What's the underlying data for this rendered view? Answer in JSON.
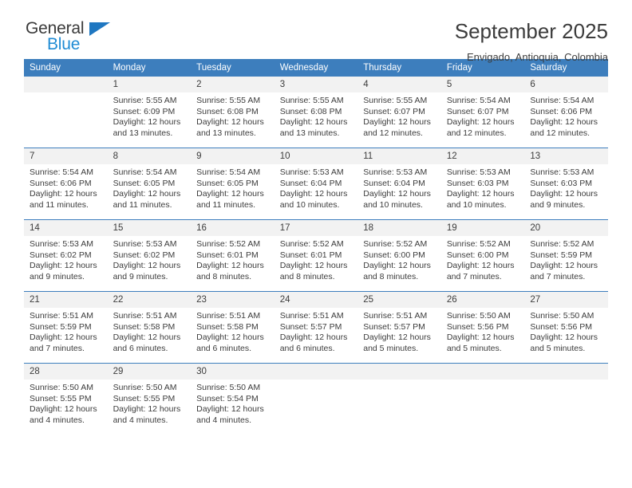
{
  "brand": {
    "name_part1": "General",
    "name_part2": "Blue",
    "accent_color": "#1f8bd4",
    "triangle_color": "#1f77c1"
  },
  "header": {
    "title": "September 2025",
    "subtitle": "Envigado, Antioquia, Colombia"
  },
  "calendar": {
    "header_color": "#3d7ebd",
    "daynum_bg": "#f2f2f2",
    "weekday_headers": [
      "Sunday",
      "Monday",
      "Tuesday",
      "Wednesday",
      "Thursday",
      "Friday",
      "Saturday"
    ],
    "weeks": [
      [
        {
          "day": "",
          "sunrise": "",
          "sunset": "",
          "daylight_line1": "",
          "daylight_line2": ""
        },
        {
          "day": "1",
          "sunrise": "Sunrise: 5:55 AM",
          "sunset": "Sunset: 6:09 PM",
          "daylight_line1": "Daylight: 12 hours",
          "daylight_line2": "and 13 minutes."
        },
        {
          "day": "2",
          "sunrise": "Sunrise: 5:55 AM",
          "sunset": "Sunset: 6:08 PM",
          "daylight_line1": "Daylight: 12 hours",
          "daylight_line2": "and 13 minutes."
        },
        {
          "day": "3",
          "sunrise": "Sunrise: 5:55 AM",
          "sunset": "Sunset: 6:08 PM",
          "daylight_line1": "Daylight: 12 hours",
          "daylight_line2": "and 13 minutes."
        },
        {
          "day": "4",
          "sunrise": "Sunrise: 5:55 AM",
          "sunset": "Sunset: 6:07 PM",
          "daylight_line1": "Daylight: 12 hours",
          "daylight_line2": "and 12 minutes."
        },
        {
          "day": "5",
          "sunrise": "Sunrise: 5:54 AM",
          "sunset": "Sunset: 6:07 PM",
          "daylight_line1": "Daylight: 12 hours",
          "daylight_line2": "and 12 minutes."
        },
        {
          "day": "6",
          "sunrise": "Sunrise: 5:54 AM",
          "sunset": "Sunset: 6:06 PM",
          "daylight_line1": "Daylight: 12 hours",
          "daylight_line2": "and 12 minutes."
        }
      ],
      [
        {
          "day": "7",
          "sunrise": "Sunrise: 5:54 AM",
          "sunset": "Sunset: 6:06 PM",
          "daylight_line1": "Daylight: 12 hours",
          "daylight_line2": "and 11 minutes."
        },
        {
          "day": "8",
          "sunrise": "Sunrise: 5:54 AM",
          "sunset": "Sunset: 6:05 PM",
          "daylight_line1": "Daylight: 12 hours",
          "daylight_line2": "and 11 minutes."
        },
        {
          "day": "9",
          "sunrise": "Sunrise: 5:54 AM",
          "sunset": "Sunset: 6:05 PM",
          "daylight_line1": "Daylight: 12 hours",
          "daylight_line2": "and 11 minutes."
        },
        {
          "day": "10",
          "sunrise": "Sunrise: 5:53 AM",
          "sunset": "Sunset: 6:04 PM",
          "daylight_line1": "Daylight: 12 hours",
          "daylight_line2": "and 10 minutes."
        },
        {
          "day": "11",
          "sunrise": "Sunrise: 5:53 AM",
          "sunset": "Sunset: 6:04 PM",
          "daylight_line1": "Daylight: 12 hours",
          "daylight_line2": "and 10 minutes."
        },
        {
          "day": "12",
          "sunrise": "Sunrise: 5:53 AM",
          "sunset": "Sunset: 6:03 PM",
          "daylight_line1": "Daylight: 12 hours",
          "daylight_line2": "and 10 minutes."
        },
        {
          "day": "13",
          "sunrise": "Sunrise: 5:53 AM",
          "sunset": "Sunset: 6:03 PM",
          "daylight_line1": "Daylight: 12 hours",
          "daylight_line2": "and 9 minutes."
        }
      ],
      [
        {
          "day": "14",
          "sunrise": "Sunrise: 5:53 AM",
          "sunset": "Sunset: 6:02 PM",
          "daylight_line1": "Daylight: 12 hours",
          "daylight_line2": "and 9 minutes."
        },
        {
          "day": "15",
          "sunrise": "Sunrise: 5:53 AM",
          "sunset": "Sunset: 6:02 PM",
          "daylight_line1": "Daylight: 12 hours",
          "daylight_line2": "and 9 minutes."
        },
        {
          "day": "16",
          "sunrise": "Sunrise: 5:52 AM",
          "sunset": "Sunset: 6:01 PM",
          "daylight_line1": "Daylight: 12 hours",
          "daylight_line2": "and 8 minutes."
        },
        {
          "day": "17",
          "sunrise": "Sunrise: 5:52 AM",
          "sunset": "Sunset: 6:01 PM",
          "daylight_line1": "Daylight: 12 hours",
          "daylight_line2": "and 8 minutes."
        },
        {
          "day": "18",
          "sunrise": "Sunrise: 5:52 AM",
          "sunset": "Sunset: 6:00 PM",
          "daylight_line1": "Daylight: 12 hours",
          "daylight_line2": "and 8 minutes."
        },
        {
          "day": "19",
          "sunrise": "Sunrise: 5:52 AM",
          "sunset": "Sunset: 6:00 PM",
          "daylight_line1": "Daylight: 12 hours",
          "daylight_line2": "and 7 minutes."
        },
        {
          "day": "20",
          "sunrise": "Sunrise: 5:52 AM",
          "sunset": "Sunset: 5:59 PM",
          "daylight_line1": "Daylight: 12 hours",
          "daylight_line2": "and 7 minutes."
        }
      ],
      [
        {
          "day": "21",
          "sunrise": "Sunrise: 5:51 AM",
          "sunset": "Sunset: 5:59 PM",
          "daylight_line1": "Daylight: 12 hours",
          "daylight_line2": "and 7 minutes."
        },
        {
          "day": "22",
          "sunrise": "Sunrise: 5:51 AM",
          "sunset": "Sunset: 5:58 PM",
          "daylight_line1": "Daylight: 12 hours",
          "daylight_line2": "and 6 minutes."
        },
        {
          "day": "23",
          "sunrise": "Sunrise: 5:51 AM",
          "sunset": "Sunset: 5:58 PM",
          "daylight_line1": "Daylight: 12 hours",
          "daylight_line2": "and 6 minutes."
        },
        {
          "day": "24",
          "sunrise": "Sunrise: 5:51 AM",
          "sunset": "Sunset: 5:57 PM",
          "daylight_line1": "Daylight: 12 hours",
          "daylight_line2": "and 6 minutes."
        },
        {
          "day": "25",
          "sunrise": "Sunrise: 5:51 AM",
          "sunset": "Sunset: 5:57 PM",
          "daylight_line1": "Daylight: 12 hours",
          "daylight_line2": "and 5 minutes."
        },
        {
          "day": "26",
          "sunrise": "Sunrise: 5:50 AM",
          "sunset": "Sunset: 5:56 PM",
          "daylight_line1": "Daylight: 12 hours",
          "daylight_line2": "and 5 minutes."
        },
        {
          "day": "27",
          "sunrise": "Sunrise: 5:50 AM",
          "sunset": "Sunset: 5:56 PM",
          "daylight_line1": "Daylight: 12 hours",
          "daylight_line2": "and 5 minutes."
        }
      ],
      [
        {
          "day": "28",
          "sunrise": "Sunrise: 5:50 AM",
          "sunset": "Sunset: 5:55 PM",
          "daylight_line1": "Daylight: 12 hours",
          "daylight_line2": "and 4 minutes."
        },
        {
          "day": "29",
          "sunrise": "Sunrise: 5:50 AM",
          "sunset": "Sunset: 5:55 PM",
          "daylight_line1": "Daylight: 12 hours",
          "daylight_line2": "and 4 minutes."
        },
        {
          "day": "30",
          "sunrise": "Sunrise: 5:50 AM",
          "sunset": "Sunset: 5:54 PM",
          "daylight_line1": "Daylight: 12 hours",
          "daylight_line2": "and 4 minutes."
        },
        {
          "day": "",
          "sunrise": "",
          "sunset": "",
          "daylight_line1": "",
          "daylight_line2": ""
        },
        {
          "day": "",
          "sunrise": "",
          "sunset": "",
          "daylight_line1": "",
          "daylight_line2": ""
        },
        {
          "day": "",
          "sunrise": "",
          "sunset": "",
          "daylight_line1": "",
          "daylight_line2": ""
        },
        {
          "day": "",
          "sunrise": "",
          "sunset": "",
          "daylight_line1": "",
          "daylight_line2": ""
        }
      ]
    ]
  }
}
